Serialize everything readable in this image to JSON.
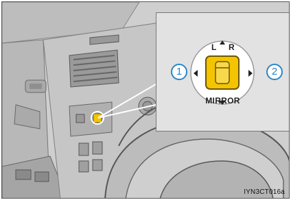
{
  "inset": {
    "label_left": "L",
    "label_right": "R",
    "label_bottom": "MIRROR",
    "callout_left": "1",
    "callout_right": "2"
  },
  "figure_code": "IYN3CT016a",
  "colors": {
    "switch_knob": "#f5c400",
    "callout_blue": "#2a86c8",
    "inset_bg": "#e2e2e2"
  }
}
